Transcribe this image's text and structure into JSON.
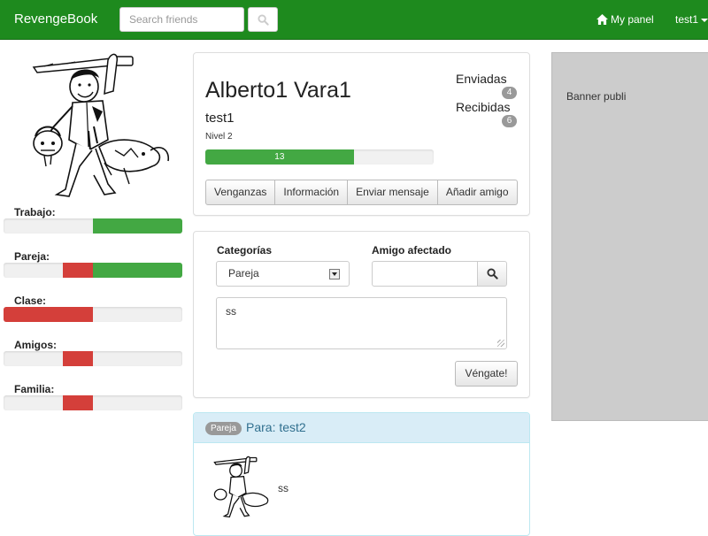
{
  "navbar": {
    "brand": "RevengeBook",
    "search_placeholder": "Search friends",
    "my_panel": "My panel",
    "user": "test1"
  },
  "stats": [
    {
      "label": "Trabajo:",
      "red": 0,
      "green": 50
    },
    {
      "label": "Pareja:",
      "red": 17,
      "green": 50
    },
    {
      "label": "Clase:",
      "red": 50,
      "green": 0
    },
    {
      "label": "Amigos:",
      "red": 17,
      "green": 0
    },
    {
      "label": "Familia:",
      "red": 17,
      "green": 0
    }
  ],
  "profile": {
    "name": "Alberto1 Vara1",
    "username": "test1",
    "level": "Nivel 2",
    "progress_value": "13",
    "progress_percent": 65,
    "sent_label": "Enviadas",
    "sent_count": "4",
    "received_label": "Recibidas",
    "received_count": "6",
    "buttons": [
      "Venganzas",
      "Información",
      "Enviar mensaje",
      "Añadir amigo"
    ]
  },
  "form": {
    "category_label": "Categorías",
    "category_value": "Pareja",
    "friend_label": "Amigo afectado",
    "friend_value": "",
    "message": "ss",
    "submit": "Véngate!"
  },
  "post": {
    "tag": "Pareja",
    "to": "Para: test2",
    "text": "ss"
  },
  "banner": {
    "text": "Banner publi"
  },
  "colors": {
    "navbar": "#1e8a1e",
    "green": "#43a843",
    "red": "#d43f3a",
    "info_heading": "#d9edf7",
    "banner": "#cccccc"
  }
}
